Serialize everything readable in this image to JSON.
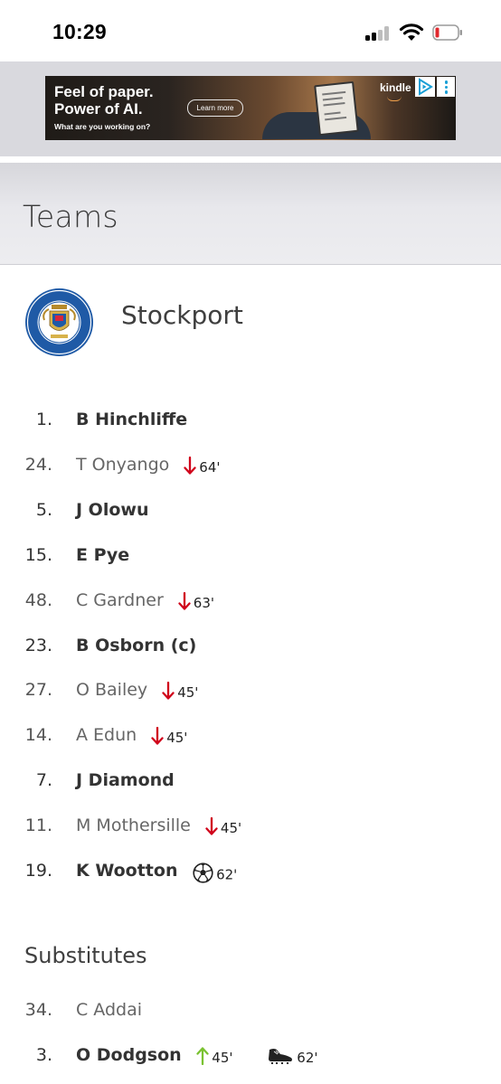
{
  "status_bar": {
    "time": "10:29"
  },
  "ad": {
    "line1": "Feel of paper.",
    "line2": "Power of AI.",
    "line3": "What are you working on?",
    "button": "Learn more",
    "brand": "kindle"
  },
  "header": {
    "title": "Teams"
  },
  "team": {
    "name": "Stockport"
  },
  "starters": [
    {
      "number": "1.",
      "name": "B  Hinchliffe",
      "bold": true
    },
    {
      "number": "24.",
      "name": "T  Onyango",
      "bold": false,
      "event": {
        "type": "sub-off",
        "icon": "arrow-down-icon",
        "minute": "64'"
      }
    },
    {
      "number": "5.",
      "name": "J  Olowu",
      "bold": true
    },
    {
      "number": "15.",
      "name": "E  Pye",
      "bold": true
    },
    {
      "number": "48.",
      "name": "C  Gardner",
      "bold": false,
      "event": {
        "type": "sub-off",
        "icon": "arrow-down-icon",
        "minute": "63'"
      }
    },
    {
      "number": "23.",
      "name": "B  Osborn (c)",
      "bold": true
    },
    {
      "number": "27.",
      "name": "O  Bailey",
      "bold": false,
      "event": {
        "type": "sub-off",
        "icon": "arrow-down-icon",
        "minute": "45'"
      }
    },
    {
      "number": "14.",
      "name": "A  Edun",
      "bold": false,
      "event": {
        "type": "sub-off",
        "icon": "arrow-down-icon",
        "minute": "45'"
      }
    },
    {
      "number": "7.",
      "name": "J  Diamond",
      "bold": true
    },
    {
      "number": "11.",
      "name": "M  Mothersille",
      "bold": false,
      "event": {
        "type": "sub-off",
        "icon": "arrow-down-icon",
        "minute": "45'"
      }
    },
    {
      "number": "19.",
      "name": "K  Wootton",
      "bold": true,
      "event": {
        "type": "goal",
        "icon": "football-icon",
        "minute": "62'"
      }
    }
  ],
  "substitutes_title": "Substitutes",
  "substitutes": [
    {
      "number": "34.",
      "name": "C  Addai",
      "bold": false
    },
    {
      "number": "3.",
      "name": "O  Dodgson",
      "bold": true,
      "event": {
        "type": "sub-on",
        "icon": "arrow-up-icon",
        "minute": "45'"
      },
      "event2": {
        "type": "assist",
        "icon": "boot-icon",
        "minute": "62'"
      }
    }
  ],
  "colors": {
    "sub_off_arrow": "#d0021b",
    "sub_on_arrow": "#7ac231",
    "crest_blue": "#1f5aa6"
  }
}
